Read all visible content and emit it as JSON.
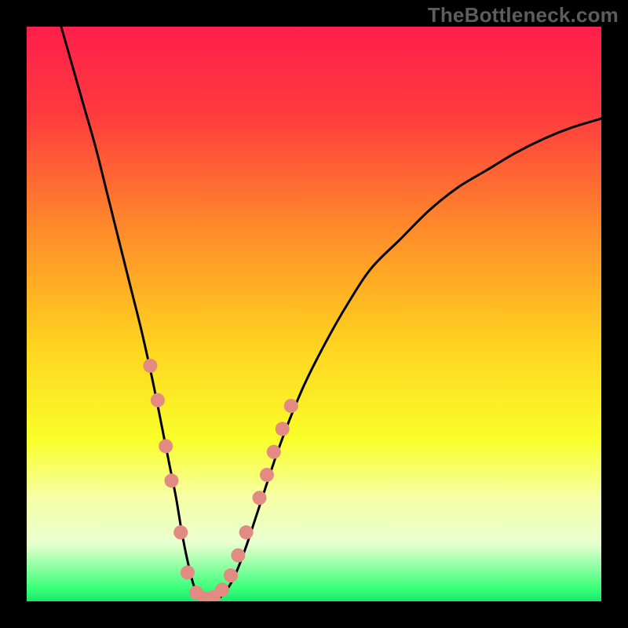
{
  "watermark": {
    "text": "TheBottleneck.com"
  },
  "gradient": {
    "stops": [
      {
        "pos": 0.0,
        "color": "#ff1f4b"
      },
      {
        "pos": 0.15,
        "color": "#ff3a3f"
      },
      {
        "pos": 0.35,
        "color": "#ff8a2a"
      },
      {
        "pos": 0.55,
        "color": "#ffd21f"
      },
      {
        "pos": 0.72,
        "color": "#f9ff2a"
      },
      {
        "pos": 0.82,
        "color": "#f6ffa6"
      },
      {
        "pos": 0.9,
        "color": "#e8ffd0"
      },
      {
        "pos": 0.98,
        "color": "#34ff76"
      },
      {
        "pos": 1.0,
        "color": "#17e86a"
      }
    ]
  },
  "curve": {
    "stroke": "#000000",
    "stroke_width": 3,
    "marker_color": "#e38a83",
    "marker_radius": 9
  },
  "chart_data": {
    "type": "line",
    "title": "",
    "xlabel": "",
    "ylabel": "",
    "xlim": [
      0,
      100
    ],
    "ylim": [
      0,
      100
    ],
    "series": [
      {
        "name": "bottleneck-curve",
        "x": [
          6,
          8,
          10,
          12,
          14,
          16,
          18,
          20,
          22,
          24,
          25,
          26,
          27,
          28,
          29,
          30,
          31,
          32,
          34,
          36,
          38,
          40,
          44,
          48,
          52,
          56,
          60,
          65,
          70,
          75,
          80,
          85,
          90,
          95,
          100
        ],
        "y": [
          100,
          93,
          86,
          79,
          71,
          63,
          55,
          47,
          38,
          28,
          23,
          18,
          12,
          7,
          3,
          1,
          0,
          0,
          1,
          4,
          9,
          15,
          27,
          37,
          45,
          52,
          58,
          63,
          68,
          72,
          75,
          78,
          80.5,
          82.5,
          84
        ]
      }
    ],
    "markers": [
      {
        "x": 21.5,
        "y": 41
      },
      {
        "x": 22.8,
        "y": 35
      },
      {
        "x": 24.2,
        "y": 27
      },
      {
        "x": 25.2,
        "y": 21
      },
      {
        "x": 26.8,
        "y": 12
      },
      {
        "x": 28.0,
        "y": 5
      },
      {
        "x": 29.5,
        "y": 1.5
      },
      {
        "x": 31.0,
        "y": 0.5
      },
      {
        "x": 32.5,
        "y": 0.7
      },
      {
        "x": 34.0,
        "y": 2
      },
      {
        "x": 35.5,
        "y": 4.5
      },
      {
        "x": 36.8,
        "y": 8
      },
      {
        "x": 38.2,
        "y": 12
      },
      {
        "x": 40.5,
        "y": 18
      },
      {
        "x": 41.8,
        "y": 22
      },
      {
        "x": 43.0,
        "y": 26
      },
      {
        "x": 44.5,
        "y": 30
      },
      {
        "x": 46.0,
        "y": 34
      }
    ]
  }
}
